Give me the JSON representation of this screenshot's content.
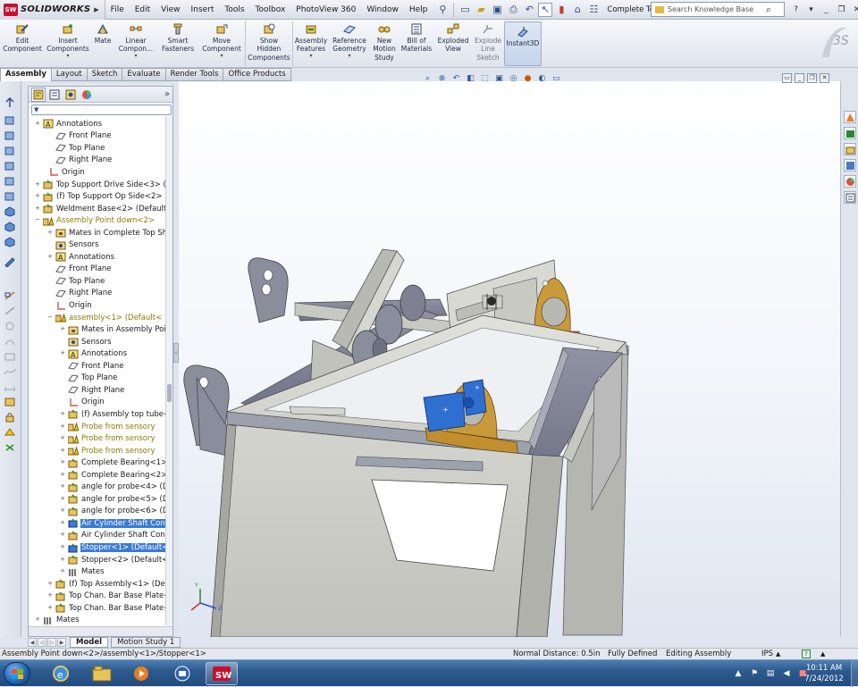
{
  "app": {
    "logo_badge": "SW",
    "logo_text": "SOLIDWORKS",
    "menu": [
      "File",
      "Edit",
      "View",
      "Insert",
      "Tools",
      "Toolbox",
      "PhotoView 360",
      "Window",
      "Help"
    ],
    "document_title": "Complete To...",
    "search_placeholder": "Search Knowledge Base",
    "help_icon": "?"
  },
  "command_manager": {
    "buttons": [
      {
        "label": "Edit\nComponent",
        "icon": "edit-component-icon"
      },
      {
        "label": "Insert\nComponents",
        "icon": "insert-components-icon"
      },
      {
        "label": "Mate",
        "icon": "mate-icon"
      },
      {
        "label": "Linear\nCompon...",
        "icon": "linear-pattern-icon"
      },
      {
        "label": "Smart\nFasteners",
        "icon": "smart-fasteners-icon"
      },
      {
        "label": "Move\nComponent",
        "icon": "move-component-icon"
      },
      {
        "label": "Show\nHidden\nComponents",
        "icon": "show-hidden-icon"
      },
      {
        "label": "Assembly\nFeatures",
        "icon": "assembly-features-icon"
      },
      {
        "label": "Reference\nGeometry",
        "icon": "reference-geometry-icon"
      },
      {
        "label": "New\nMotion\nStudy",
        "icon": "motion-study-icon"
      },
      {
        "label": "Bill of\nMaterials",
        "icon": "bom-icon"
      },
      {
        "label": "Exploded\nView",
        "icon": "exploded-view-icon"
      },
      {
        "label": "Explode\nLine\nSketch",
        "icon": "explode-line-icon"
      },
      {
        "label": "Instant3D",
        "icon": "instant3d-icon"
      }
    ],
    "tabs": [
      "Assembly",
      "Layout",
      "Sketch",
      "Evaluate",
      "Render Tools",
      "Office Products"
    ],
    "active_tab": "Assembly"
  },
  "feature_tree": {
    "filter_icon": "filter-icon",
    "items": [
      {
        "label": "Annotations",
        "icon": "annotations-icon",
        "expand": "+"
      },
      {
        "label": "Front Plane",
        "icon": "plane-icon",
        "expand": ""
      },
      {
        "label": "Top Plane",
        "icon": "plane-icon",
        "expand": ""
      },
      {
        "label": "Right Plane",
        "icon": "plane-icon",
        "expand": ""
      },
      {
        "label": "Origin",
        "icon": "origin-icon",
        "expand": ""
      },
      {
        "label": "Top Support Drive Side<3> (D",
        "icon": "part-icon",
        "expand": "+"
      },
      {
        "label": "(f) Top Support Op Side<2> (D",
        "icon": "part-icon",
        "expand": "+"
      },
      {
        "label": "Weldment Base<2> (Default<",
        "icon": "part-icon",
        "expand": "+"
      },
      {
        "label": "Assembly Point down<2>",
        "icon": "subassembly-warning-icon",
        "expand": "−",
        "warn": true
      },
      {
        "label": "Mates in Complete Top Sh",
        "icon": "mates-folder-icon",
        "expand": "+"
      },
      {
        "label": "Sensors",
        "icon": "sensors-icon",
        "expand": ""
      },
      {
        "label": "Annotations",
        "icon": "annotations-icon",
        "expand": "+"
      },
      {
        "label": "Front Plane",
        "icon": "plane-icon",
        "expand": ""
      },
      {
        "label": "Top Plane",
        "icon": "plane-icon",
        "expand": ""
      },
      {
        "label": "Right Plane",
        "icon": "plane-icon",
        "expand": ""
      },
      {
        "label": "Origin",
        "icon": "origin-icon",
        "expand": ""
      },
      {
        "label": "assembly<1> (Default<",
        "icon": "subassembly-warning-icon",
        "expand": "−",
        "warn": true
      },
      {
        "label": "Mates in Assembly Poi",
        "icon": "mates-folder-icon",
        "expand": "+"
      },
      {
        "label": "Sensors",
        "icon": "sensors-icon",
        "expand": ""
      },
      {
        "label": "Annotations",
        "icon": "annotations-icon",
        "expand": "+"
      },
      {
        "label": "Front Plane",
        "icon": "plane-icon",
        "expand": ""
      },
      {
        "label": "Top Plane",
        "icon": "plane-icon",
        "expand": ""
      },
      {
        "label": "Right Plane",
        "icon": "plane-icon",
        "expand": ""
      },
      {
        "label": "Origin",
        "icon": "origin-icon",
        "expand": ""
      },
      {
        "label": "(f) Assembly top tube<",
        "icon": "part-icon",
        "expand": "+"
      },
      {
        "label": "Probe from sensory",
        "icon": "part-warning-icon",
        "expand": "+",
        "warn": true
      },
      {
        "label": "Probe from sensory",
        "icon": "part-warning-icon",
        "expand": "+",
        "warn": true
      },
      {
        "label": "Probe from sensory",
        "icon": "part-warning-icon",
        "expand": "+",
        "warn": true
      },
      {
        "label": "Complete Bearing<1>",
        "icon": "part-icon",
        "expand": "+"
      },
      {
        "label": "Complete Bearing<2>",
        "icon": "part-icon",
        "expand": "+"
      },
      {
        "label": "angle for probe<4> (De",
        "icon": "part-icon",
        "expand": "+"
      },
      {
        "label": "angle for probe<5> (De",
        "icon": "part-icon",
        "expand": "+"
      },
      {
        "label": "angle for probe<6> (De",
        "icon": "part-icon",
        "expand": "+"
      },
      {
        "label": "Air Cylinder Shaft Conn",
        "icon": "part-selected-icon",
        "expand": "+",
        "selected": true
      },
      {
        "label": "Air Cylinder Shaft Conn",
        "icon": "part-icon",
        "expand": "+"
      },
      {
        "label": "Stopper<1> (Default<<",
        "icon": "part-selected-icon",
        "expand": "+",
        "selected": true
      },
      {
        "label": "Stopper<2> (Default<<",
        "icon": "part-icon",
        "expand": "+"
      },
      {
        "label": "Mates",
        "icon": "mates-icon",
        "expand": "+"
      },
      {
        "label": "(f) Top Assembly<1> (Def",
        "icon": "part-icon",
        "expand": "+"
      },
      {
        "label": "Top Chan. Bar Base Plate<",
        "icon": "part-icon",
        "expand": "+"
      },
      {
        "label": "Top Chan. Bar Base Plate<",
        "icon": "part-icon",
        "expand": "+"
      },
      {
        "label": "Mates",
        "icon": "mates-icon",
        "expand": "+"
      }
    ]
  },
  "bottom_tabs": [
    "Model",
    "Motion Study 1"
  ],
  "status_bar": {
    "path": "Assembly Point down<2>/assembly<1>/Stopper<1>",
    "normal_distance": "Normal Distance: 0.5in",
    "defined": "Fully Defined",
    "mode": "Editing Assembly",
    "units": "IPS"
  },
  "taskbar": {
    "apps": [
      "windows-explorer-icon",
      "internet-explorer-icon",
      "file-explorer-icon",
      "media-player-icon",
      "outlook-icon",
      "solidworks-icon"
    ],
    "time": "10:11 AM",
    "date": "7/24/2012"
  },
  "colors": {
    "selection": "#3a7bd5",
    "model_gray": "#c9c9c4",
    "bearing_orange": "#c18f2e",
    "selected_part_blue": "#2f6fd0"
  }
}
